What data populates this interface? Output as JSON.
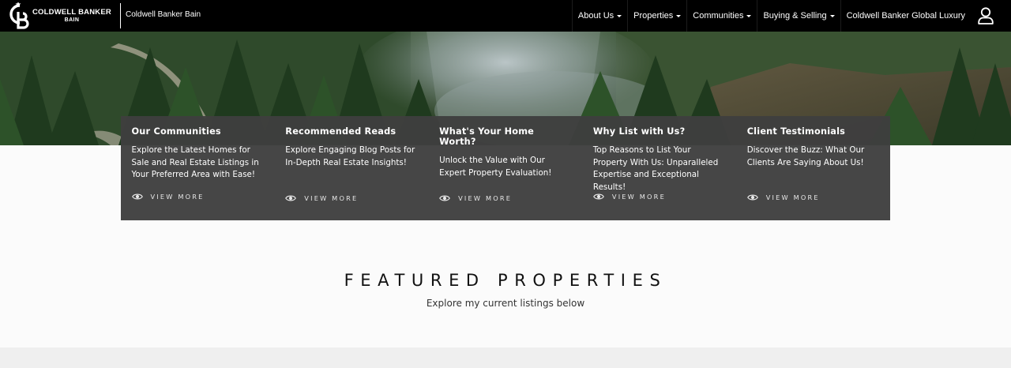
{
  "header": {
    "logo_brand": "COLDWELL BANKER",
    "logo_sub": "BAIN",
    "office_name": "Coldwell Banker Bain",
    "nav": [
      {
        "label": "About Us",
        "has_dropdown": true
      },
      {
        "label": "Properties",
        "has_dropdown": true
      },
      {
        "label": "Communities",
        "has_dropdown": true
      },
      {
        "label": "Buying & Selling",
        "has_dropdown": true
      },
      {
        "label": "Coldwell Banker Global Luxury",
        "has_dropdown": false
      }
    ],
    "user_icon": "user-icon"
  },
  "cards": [
    {
      "title": "Our Communities",
      "description": "Explore the Latest Homes for Sale and Real Estate Listings in Your Preferred Area with Ease!",
      "link": "VIEW MORE",
      "icon": "eye-icon"
    },
    {
      "title": "Recommended Reads",
      "description": "Explore Engaging Blog Posts for In-Depth Real Estate Insights!",
      "link": "VIEW MORE",
      "icon": "eye-icon"
    },
    {
      "title": "What's Your Home Worth?",
      "description": "Unlock the Value with Our Expert Property Evaluation!",
      "link": "VIEW MORE",
      "icon": "eye-icon"
    },
    {
      "title": "Why List with Us?",
      "description": "Top Reasons to List Your Property With Us: Unparalleled Expertise and Exceptional Results!",
      "link": "VIEW MORE",
      "icon": "eye-icon"
    },
    {
      "title": "Client Testimonials",
      "description": "Discover the Buzz: What Our Clients Are Saying About Us!",
      "link": "VIEW MORE",
      "icon": "eye-icon"
    }
  ],
  "featured": {
    "title": "FEATURED PROPERTIES",
    "subtitle": "Explore my current listings below"
  },
  "colors": {
    "header_bg": "#000000",
    "panel_bg": "#3e3e3e",
    "page_bg": "#fbfbfb"
  }
}
